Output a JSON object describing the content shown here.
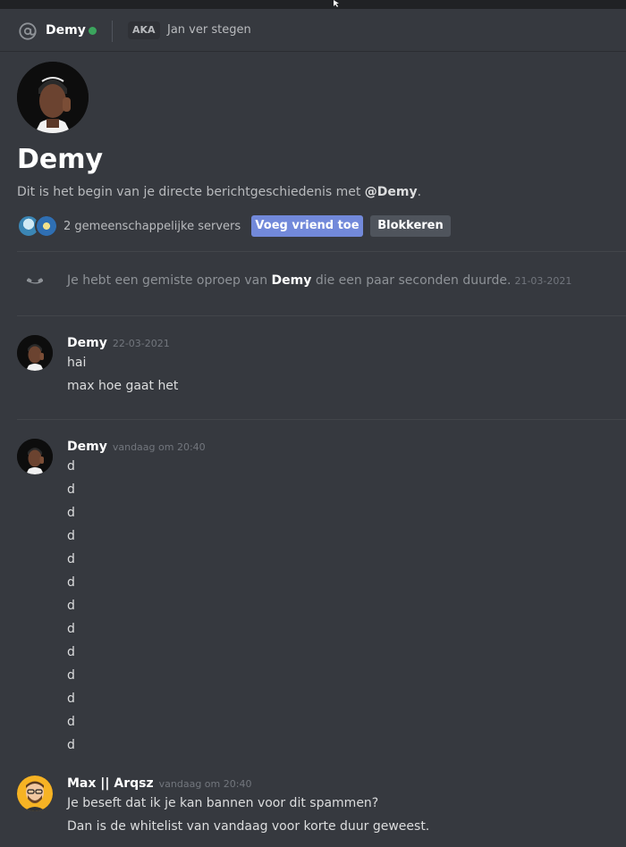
{
  "header": {
    "username": "Demy",
    "aka_label": "AKA",
    "aka_name": "Jan ver stegen"
  },
  "profile": {
    "name": "Demy",
    "intro_text": "Dit is het begin van je directe berichtgeschiedenis met ",
    "intro_mention": "@Demy",
    "intro_end": ".",
    "mutual_servers": "2 gemeenschappelijke servers",
    "add_friend_label": "Voeg vriend toe",
    "block_label": "Blokkeren"
  },
  "call": {
    "text_before": "Je hebt een gemiste oproep van ",
    "caller": "Demy",
    "text_after": " die een paar seconden duurde.",
    "date": "21-03-2021"
  },
  "messages": [
    {
      "author": "Demy",
      "timestamp": "22-03-2021",
      "lines": [
        "hai",
        "max hoe gaat het"
      ]
    },
    {
      "author": "Demy",
      "timestamp": "vandaag om 20:40",
      "lines": [
        "d",
        "d",
        "d",
        "d",
        "d",
        "d",
        "d",
        "d",
        "d",
        "d",
        "d",
        "d",
        "d"
      ]
    },
    {
      "author": "Max || Arqsz",
      "timestamp": "vandaag om 20:40",
      "lines": [
        "Je beseft dat ik je kan bannen voor dit spammen?",
        "Dan is de whitelist van vandaag voor korte duur geweest."
      ]
    }
  ],
  "colors": {
    "background": "#36393f",
    "accent": "#7289da",
    "online": "#3ba55d",
    "secondary_button": "#4f545c"
  },
  "icons": {
    "at": "at-sign-icon",
    "status": "online-status-icon",
    "call": "phone-icon"
  }
}
